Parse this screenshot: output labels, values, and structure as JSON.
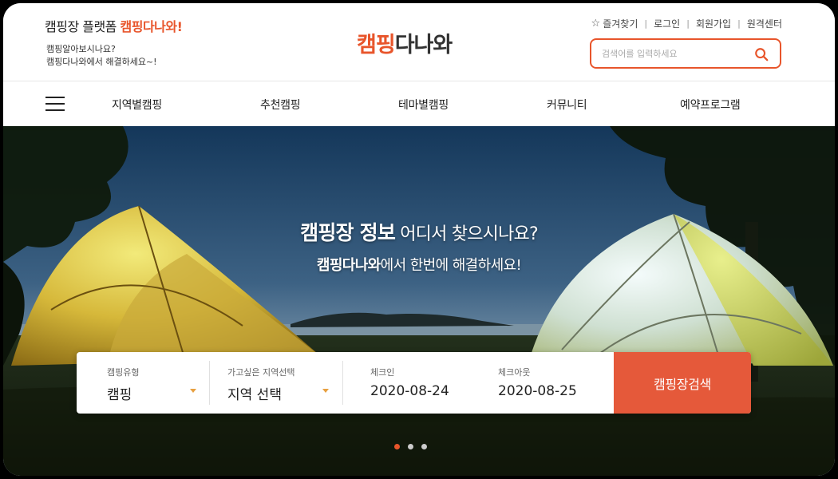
{
  "header": {
    "tagline_prefix": "캠핑장 플랫폼",
    "tagline_highlight": "캠핑다나와!",
    "subtext_line1": "캠핑알아보시나요?",
    "subtext_line2": "캠핑다나와에서 해결하세요~!",
    "logo_part1": "캠핑",
    "logo_part2": "다나와",
    "util_links": {
      "favorites": "즐겨찾기",
      "login": "로그인",
      "signup": "회원가입",
      "remote_center": "원격센터"
    },
    "search_placeholder": "검색어를 입력하세요"
  },
  "nav": {
    "items": [
      "지역별캠핑",
      "추천캠핑",
      "테마별캠핑",
      "커뮤니티",
      "예약프로그램"
    ]
  },
  "hero": {
    "title_bold": "캠핑장 정보",
    "title_light": " 어디서 찾으시나요?",
    "sub_bold": "캠핑다나와",
    "sub_light": "에서 한번에 해결하세요!"
  },
  "booking": {
    "type_label": "캠핑유형",
    "type_value": "캠핑",
    "region_label": "가고싶은 지역선택",
    "region_value": "지역 선택",
    "checkin_label": "체크인",
    "checkin_value": "2020-08-24",
    "checkout_label": "체크아웃",
    "checkout_value": "2020-08-25",
    "search_button": "캠핑장검색"
  },
  "carousel": {
    "slide_count": 3,
    "active_index": 0
  },
  "colors": {
    "accent": "#e8552b",
    "button": "#e5593a"
  }
}
